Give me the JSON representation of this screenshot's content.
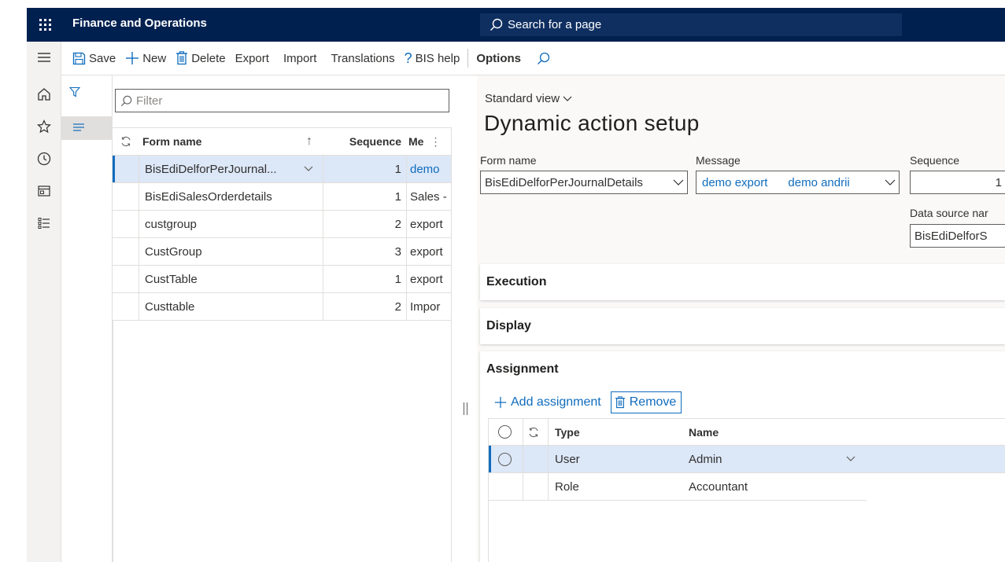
{
  "navbar": {
    "app_title": "Finance and Operations",
    "search_placeholder": "Search for a page"
  },
  "toolbar": {
    "save": "Save",
    "new": "New",
    "delete": "Delete",
    "export": "Export",
    "import": "Import",
    "translations": "Translations",
    "bis_help": "BIS help",
    "options": "Options"
  },
  "list": {
    "filter_placeholder": "Filter",
    "columns": {
      "form_name": "Form name",
      "sequence": "Sequence",
      "message": "Me"
    },
    "rows": [
      {
        "form_name": "BisEdiDelforPerJournal...",
        "sequence": "1",
        "message": "demo"
      },
      {
        "form_name": "BisEdiSalesOrderdetails",
        "sequence": "1",
        "message": "Sales -"
      },
      {
        "form_name": "custgroup",
        "sequence": "2",
        "message": "export"
      },
      {
        "form_name": "CustGroup",
        "sequence": "3",
        "message": "export"
      },
      {
        "form_name": "CustTable",
        "sequence": "1",
        "message": "export"
      },
      {
        "form_name": "Custtable",
        "sequence": "2",
        "message": "Impor"
      }
    ]
  },
  "details": {
    "view_name": "Standard view",
    "page_title": "Dynamic action setup",
    "form_name_label": "Form name",
    "form_name_value": "BisEdiDelforPerJournalDetails",
    "message_label": "Message",
    "message_value_1": "demo export",
    "message_value_2": "demo andrii",
    "sequence_label": "Sequence",
    "sequence_value": "1",
    "datasource_label": "Data source nar",
    "datasource_value": "BisEdiDelforS",
    "fasttabs": {
      "execution": "Execution",
      "display": "Display",
      "assignment": "Assignment"
    },
    "assignment": {
      "add_label": "Add assignment",
      "remove_label": "Remove",
      "columns": {
        "type": "Type",
        "name": "Name"
      },
      "rows": [
        {
          "type": "User",
          "name": "Admin"
        },
        {
          "type": "Role",
          "name": "Accountant"
        }
      ]
    }
  },
  "colors": {
    "navbar": "#002050",
    "accent": "#0f6cbd",
    "selected_row": "#dce7f7"
  }
}
